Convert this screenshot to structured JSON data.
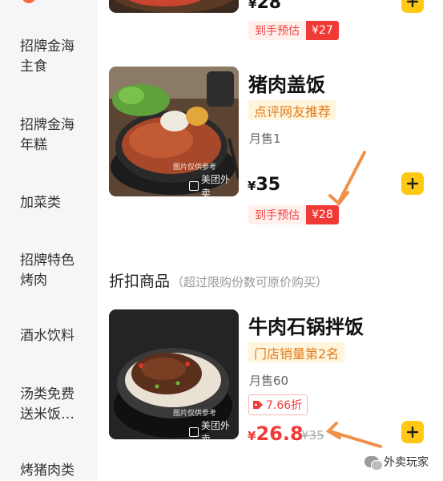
{
  "sidebar": {
    "items": [
      {
        "line1": "招牌金海",
        "line2": "主食"
      },
      {
        "line1": "招牌金海",
        "line2": "年糕"
      },
      {
        "line1": "加菜类",
        "line2": ""
      },
      {
        "line1": "招牌特色",
        "line2": "烤肉"
      },
      {
        "line1": "酒水饮料",
        "line2": ""
      },
      {
        "line1": "汤类免费",
        "line2": "送米饭…"
      },
      {
        "line1": "烤猪肉类",
        "line2": ""
      }
    ]
  },
  "products": [
    {
      "price_symbol": "¥",
      "price": "28",
      "coupon_label": "到手预估",
      "coupon_price": "¥27"
    },
    {
      "title": "猪肉盖饭",
      "badge": "点评网友推荐",
      "sold": "月售1",
      "price_symbol": "¥",
      "price": "35",
      "coupon_label": "到手预估",
      "coupon_price": "¥28",
      "watermark": "美团外卖"
    },
    {
      "title": "牛肉石锅拌饭",
      "badge": "门店销量第2名",
      "sold": "月售60",
      "discount": "7.66折",
      "price_symbol": "¥",
      "price": "26.8",
      "original_price": "¥35",
      "watermark": "美团外卖"
    }
  ],
  "section": {
    "title": "折扣商品",
    "subtitle": "（超过限购份数可原价购买）"
  },
  "footer_watermark": "外卖玩家",
  "colors": {
    "accent_yellow": "#ffc814",
    "price_red": "#f03a36",
    "badge_orange": "#e07b1c",
    "arrow_orange": "#f29047"
  },
  "icons": [
    "plus-icon",
    "discount-tag-icon",
    "wechat-icon",
    "arrow-annotation"
  ]
}
